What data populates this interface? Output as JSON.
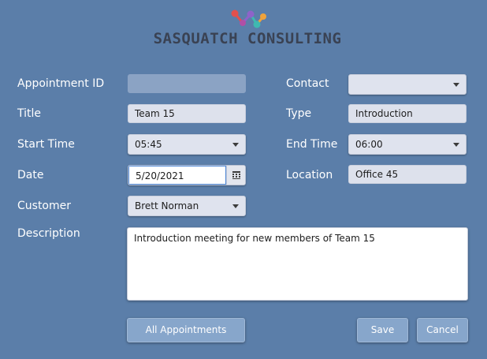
{
  "header": {
    "logo_icon": "network-nodes-icon",
    "brand_name": "SASQUATCH CONSULTING"
  },
  "form": {
    "appointment_id": {
      "label": "Appointment ID",
      "value": ""
    },
    "title": {
      "label": "Title",
      "value": "Team 15"
    },
    "start_time": {
      "label": "Start Time",
      "value": "05:45"
    },
    "date": {
      "label": "Date",
      "value": "5/20/2021"
    },
    "customer": {
      "label": "Customer",
      "value": "Brett Norman"
    },
    "contact": {
      "label": "Contact",
      "value": ""
    },
    "type": {
      "label": "Type",
      "value": "Introduction"
    },
    "end_time": {
      "label": "End Time",
      "value": "06:00"
    },
    "location": {
      "label": "Location",
      "value": "Office 45"
    },
    "description": {
      "label": "Description",
      "value": "Introduction meeting for new members of Team 15"
    }
  },
  "buttons": {
    "all_appointments": "All Appointments",
    "save": "Save",
    "cancel": "Cancel"
  },
  "colors": {
    "background": "#5b7ea9",
    "button": "#87a6cb",
    "field": "#dde1ec",
    "logo_red": "#e2504d",
    "logo_purple": "#8e63c9",
    "logo_teal": "#3fb9b0",
    "logo_orange": "#f0a33a"
  }
}
